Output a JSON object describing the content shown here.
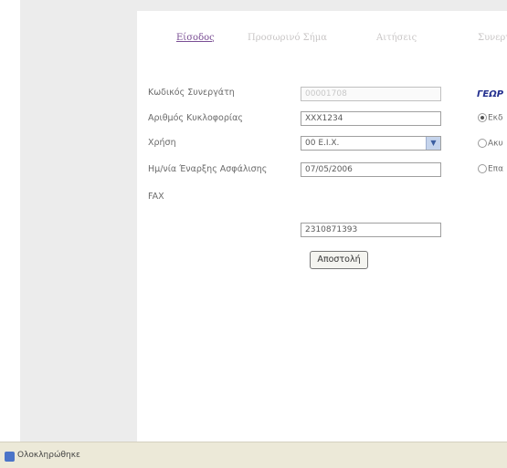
{
  "nav": {
    "tabs": [
      {
        "label": "Είσοδος",
        "active": true
      },
      {
        "label": "Προσωρινό Σήμα",
        "active": false
      },
      {
        "label": "Αιτήσεις",
        "active": false
      },
      {
        "label": "Συνεργ",
        "active": false
      }
    ]
  },
  "form": {
    "partner_code": {
      "label": "Κωδικός Συνεργάτη",
      "value": "00001708"
    },
    "plate": {
      "label": "Αριθμός Κυκλοφορίας",
      "value": "XXX1234"
    },
    "usage": {
      "label": "Χρήση",
      "value": "00 Ε.Ι.Χ."
    },
    "start_date": {
      "label": "Ημ/νία Έναρξης Ασφάλισης",
      "value": "07/05/2006"
    },
    "fax": {
      "label": "FAX",
      "value": "2310871393"
    },
    "submit_label": "Αποστολή"
  },
  "side_section": {
    "title": "ΓΕΩΡ",
    "options": [
      {
        "label": "Εκδ",
        "selected": true
      },
      {
        "label": "Ακυ",
        "selected": false
      },
      {
        "label": "Επα",
        "selected": false
      }
    ]
  },
  "statusbar": {
    "text": "Ολοκληρώθηκε"
  },
  "colors": {
    "active_tab": "#7a4e94",
    "section_title": "#24308f",
    "panel": "#ececec"
  }
}
